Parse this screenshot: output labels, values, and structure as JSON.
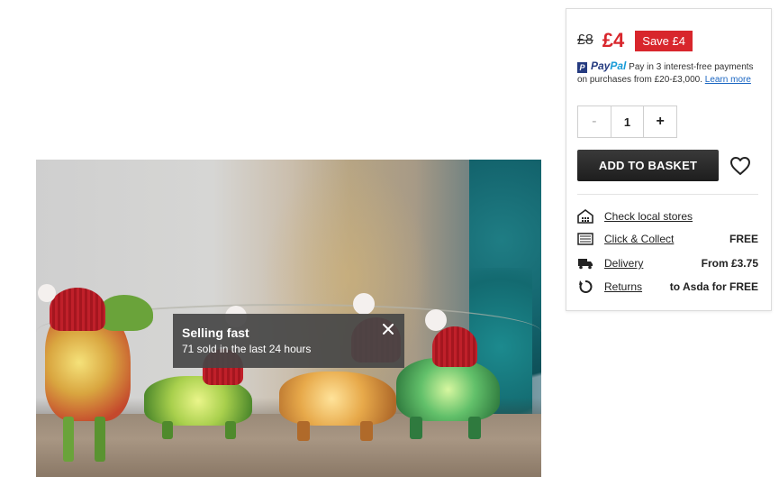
{
  "product_image": {
    "alt": "Dinosaur fairy lights with Christmas hats"
  },
  "toast": {
    "title": "Selling fast",
    "subtitle": "71 sold in the last 24 hours",
    "close_icon": "close-icon"
  },
  "pricing": {
    "old_price": "£8",
    "new_price": "£4",
    "save_badge": "Save £4",
    "colors": {
      "sale": "#d8262c"
    }
  },
  "paypal": {
    "logo_pay": "Pay",
    "logo_pal": "Pal",
    "mark": "P",
    "text": "Pay in 3 interest-free payments on purchases from £20-£3,000.",
    "learn_more": "Learn more"
  },
  "quantity": {
    "minus": "-",
    "value": "1",
    "plus": "+"
  },
  "actions": {
    "add_to_basket": "ADD TO BASKET",
    "wishlist_icon": "heart-icon"
  },
  "services": [
    {
      "icon": "store-icon",
      "label": "Check local stores",
      "value": ""
    },
    {
      "icon": "click-collect-icon",
      "label": "Click & Collect",
      "value": "FREE"
    },
    {
      "icon": "truck-icon",
      "label": "Delivery",
      "value": "From £3.75"
    },
    {
      "icon": "returns-icon",
      "label": "Returns",
      "value": "to Asda for FREE"
    }
  ]
}
